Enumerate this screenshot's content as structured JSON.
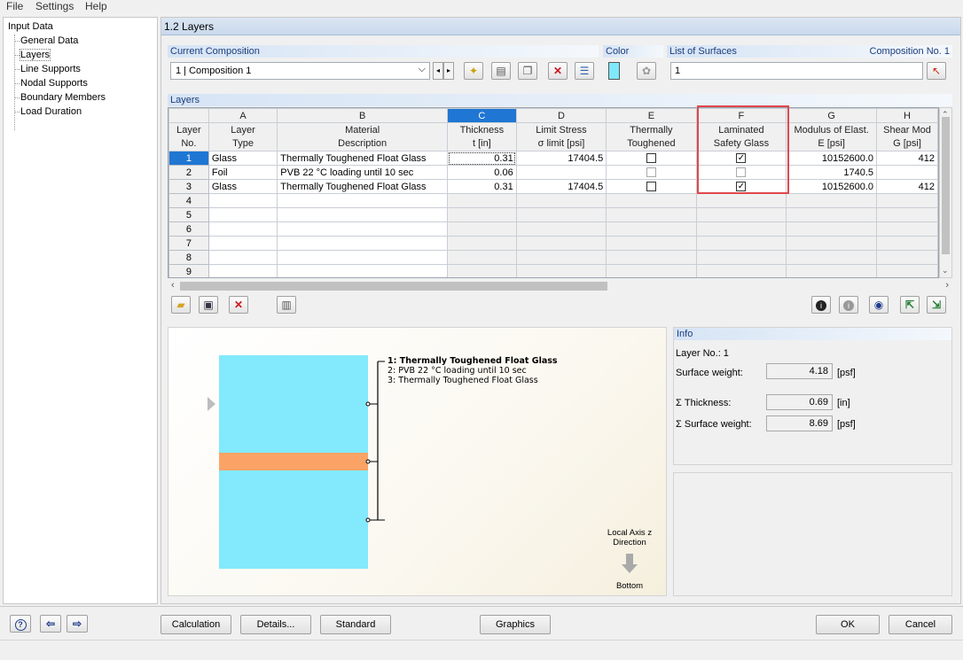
{
  "menu": {
    "file": "File",
    "settings": "Settings",
    "help": "Help"
  },
  "nav": {
    "root": "Input Data",
    "items": [
      "General Data",
      "Layers",
      "Line Supports",
      "Nodal Supports",
      "Boundary Members",
      "Load Duration"
    ]
  },
  "title": "1.2 Layers",
  "composition": {
    "header": "Current Composition",
    "value": "1 | Composition 1"
  },
  "color": {
    "header": "Color",
    "swatch": "#7fe8fb"
  },
  "surfaces": {
    "header": "List of Surfaces",
    "composition_no": "Composition No. 1",
    "value": "1"
  },
  "layers": {
    "header": "Layers",
    "col_letters": [
      "A",
      "B",
      "C",
      "D",
      "E",
      "F",
      "G",
      "H"
    ],
    "row_header_line1": "Layer",
    "row_header_line2": "No.",
    "headers": [
      [
        "Layer",
        "Type"
      ],
      [
        "Material",
        "Description"
      ],
      [
        "Thickness",
        "t [in]"
      ],
      [
        "Limit Stress",
        "σ limit [psi]"
      ],
      [
        "Thermally",
        "Toughened"
      ],
      [
        "Laminated",
        "Safety Glass"
      ],
      [
        "Modulus of Elast.",
        "E [psi]"
      ],
      [
        "Shear Mod",
        "G [psi]"
      ]
    ],
    "rows": [
      {
        "no": "1",
        "type": "Glass",
        "desc": "Thermally Toughened Float Glass",
        "t": "0.31",
        "sigma": "17404.5",
        "thermal": false,
        "laminated": true,
        "e": "10152600.0",
        "g": "412"
      },
      {
        "no": "2",
        "type": "Foil",
        "desc": "PVB 22 °C loading until 10 sec",
        "t": "0.06",
        "sigma": "",
        "thermal": false,
        "laminated": false,
        "e": "1740.5",
        "g": ""
      },
      {
        "no": "3",
        "type": "Glass",
        "desc": "Thermally Toughened Float Glass",
        "t": "0.31",
        "sigma": "17404.5",
        "thermal": false,
        "laminated": true,
        "e": "10152600.0",
        "g": "412"
      }
    ],
    "empty_rows": [
      "4",
      "5",
      "6",
      "7",
      "8",
      "9"
    ]
  },
  "graphic": {
    "legend": [
      "1: Thermally Toughened Float Glass",
      "2: PVB 22 °C loading until 10 sec",
      "3: Thermally Toughened Float Glass"
    ],
    "axis_line1": "Local Axis z",
    "axis_line2": "Direction",
    "axis_bottom": "Bottom",
    "glass_color": "#83e9fc",
    "foil_color": "#fba366"
  },
  "info": {
    "header": "Info",
    "layer_no": "Layer No.: 1",
    "surface_weight_label": "Surface weight:",
    "surface_weight": "4.18",
    "surface_weight_unit": "[psf]",
    "sum_thickness_label": "Σ Thickness:",
    "sum_thickness": "0.69",
    "sum_thickness_unit": "[in]",
    "sum_weight_label": "Σ Surface weight:",
    "sum_weight": "8.69",
    "sum_weight_unit": "[psf]"
  },
  "buttons": {
    "calculation": "Calculation",
    "details": "Details...",
    "standard": "Standard",
    "graphics": "Graphics",
    "ok": "OK",
    "cancel": "Cancel"
  }
}
